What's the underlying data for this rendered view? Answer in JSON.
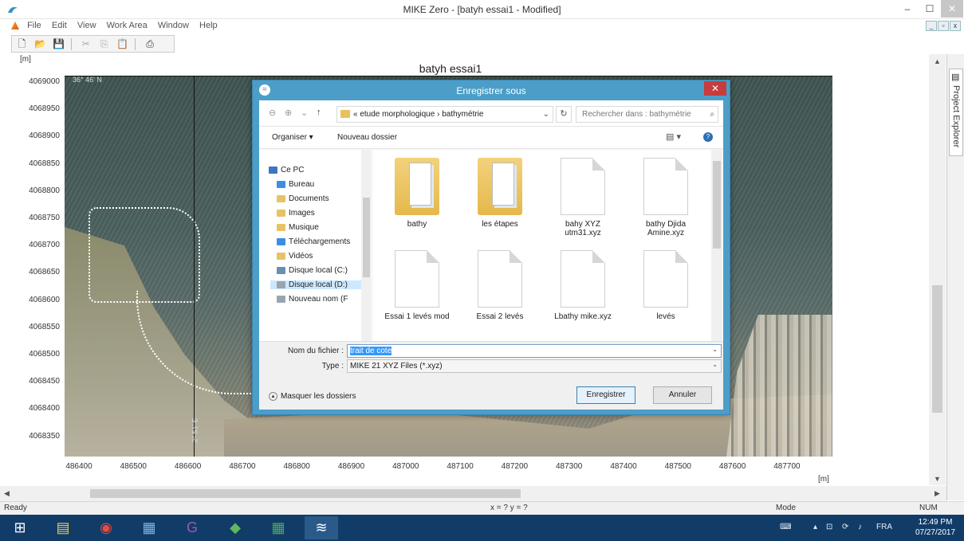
{
  "window": {
    "title": "MIKE Zero - [batyh essai1 - Modified]",
    "min": "–",
    "max": "☐",
    "close": "✕"
  },
  "menu": {
    "items": [
      "File",
      "Edit",
      "View",
      "Work Area",
      "Window",
      "Help"
    ]
  },
  "toolbar": {
    "icons": [
      "new-icon",
      "open-icon",
      "save-icon",
      "cut-icon",
      "copy-icon",
      "paste-icon",
      "print-icon",
      "help-icon",
      "context-help-icon"
    ]
  },
  "plot": {
    "title": "batyh essai1",
    "y_unit": "[m]",
    "x_unit": "[m]",
    "lat_label": "36° 46' N",
    "lon_label": "2° 51' E",
    "y_ticks": [
      "4069000",
      "4068950",
      "4068900",
      "4068850",
      "4068800",
      "4068750",
      "4068700",
      "4068650",
      "4068600",
      "4068550",
      "4068500",
      "4068450",
      "4068400",
      "4068350"
    ],
    "x_ticks": [
      "486400",
      "486500",
      "486600",
      "486700",
      "486800",
      "486900",
      "487000",
      "487100",
      "487200",
      "487300",
      "487400",
      "487500",
      "487600",
      "487700"
    ]
  },
  "project_explorer": {
    "label": "Project Explorer"
  },
  "status": {
    "ready": "Ready",
    "coords": "x = ? y = ?",
    "mode": "Mode",
    "num": "NUM"
  },
  "dialog": {
    "title": "Enregistrer sous",
    "close": "✕",
    "address": {
      "prefix": "«",
      "segment1": "etude morphologique",
      "separator": "›",
      "segment2": "bathymétrie"
    },
    "search_placeholder": "Rechercher dans : bathymétrie",
    "organize": "Organiser ▾",
    "new_folder": "Nouveau dossier",
    "nav_items": [
      "Ce PC",
      "Bureau",
      "Documents",
      "Images",
      "Musique",
      "Téléchargements",
      "Vidéos",
      "Disque local (C:)",
      "Disque local (D:)",
      "Nouveau nom (F"
    ],
    "files": [
      "bathy",
      "les étapes",
      "bahy XYZ utm31.xyz",
      "bathy Djida Amine.xyz",
      "Essai 1 levés mod",
      "Essai 2 levés",
      "Lbathy mike.xyz",
      "levés"
    ],
    "filename_label": "Nom du fichier :",
    "filename_value": "trait de cote",
    "type_label": "Type :",
    "type_value": "MIKE 21 XYZ Files (*.xyz)",
    "hide_folders": "Masquer les dossiers",
    "save_button": "Enregistrer",
    "cancel_button": "Annuler"
  },
  "taskbar": {
    "lang": "FRA",
    "time": "12:49 PM",
    "date": "07/27/2017"
  },
  "colors": {
    "dialog_frame": "#4c9ec9",
    "taskbar": "#123c68",
    "selection": "#3399ff"
  }
}
